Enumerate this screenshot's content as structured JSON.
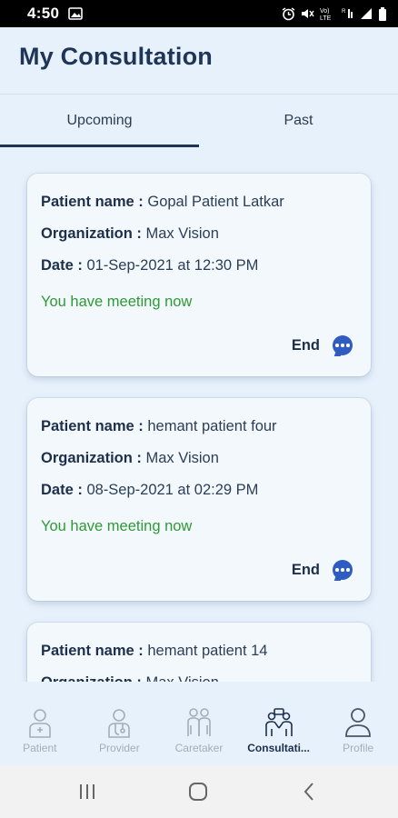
{
  "status_bar": {
    "time": "4:50",
    "icons": [
      "image-icon",
      "alarm-icon",
      "mute-icon",
      "volte-icon",
      "wifi-icon",
      "signal-icon",
      "battery-icon"
    ]
  },
  "header": {
    "title": "My Consultation"
  },
  "tabs": [
    {
      "label": "Upcoming",
      "active": true
    },
    {
      "label": "Past",
      "active": false
    }
  ],
  "consultations": [
    {
      "patient_label": "Patient name :",
      "patient_name": "Gopal Patient Latkar",
      "org_label": "Organization :",
      "organization": "Max Vision",
      "date_label": "Date :",
      "date": "01-Sep-2021 at 12:30 PM",
      "status": "You have meeting now",
      "action": "End"
    },
    {
      "patient_label": "Patient name :",
      "patient_name": "hemant patient four",
      "org_label": "Organization :",
      "organization": "Max Vision",
      "date_label": "Date :",
      "date": "08-Sep-2021 at 02:29 PM",
      "status": "You have meeting now",
      "action": "End"
    },
    {
      "patient_label": "Patient name :",
      "patient_name": "hemant patient  14",
      "org_label": "Organization :",
      "organization": "Max Vision"
    }
  ],
  "bottom_nav": [
    {
      "label": "Patient",
      "icon": "patient-icon",
      "active": false
    },
    {
      "label": "Provider",
      "icon": "provider-icon",
      "active": false
    },
    {
      "label": "Caretaker",
      "icon": "caretaker-icon",
      "active": false
    },
    {
      "label": "Consultati...",
      "icon": "consultation-icon",
      "active": true
    },
    {
      "label": "Profile",
      "icon": "profile-icon",
      "active": false
    }
  ],
  "colors": {
    "background": "#e7f1fb",
    "title": "#1f3557",
    "status_green": "#2f9a35",
    "chat_blue": "#2f5cc0",
    "inactive_nav": "#a4adb8"
  }
}
